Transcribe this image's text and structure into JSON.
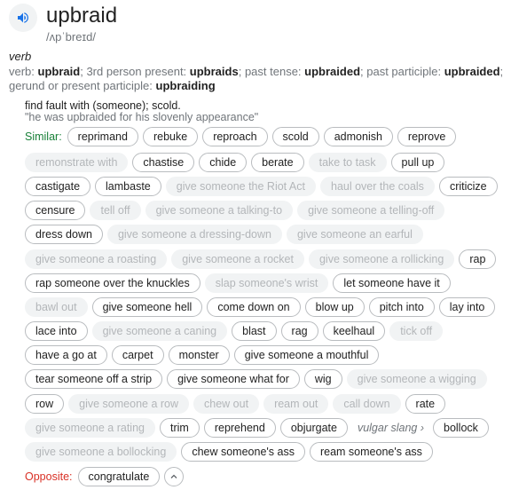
{
  "entry": {
    "word": "upbraid",
    "phonetic": "/ʌpˈbreɪd/",
    "part_of_speech": "verb"
  },
  "forms": {
    "verb_label": "verb:",
    "verb": "upbraid",
    "p3_label": "3rd person present:",
    "p3": "upbraids",
    "past_label": "past tense:",
    "past": "upbraided",
    "pp_label": "past participle:",
    "pp": "upbraided",
    "ger_label": "gerund or present participle:",
    "ger": "upbraiding"
  },
  "definition": "find fault with (someone); scold.",
  "example": "\"he was upbraided for his slovenly appearance\"",
  "similar_label": "Similar:",
  "opposite_label": "Opposite:",
  "vulgar_slang_label": "vulgar slang",
  "rows": [
    [
      [
        "reprimand",
        true
      ],
      [
        "rebuke",
        true
      ],
      [
        "reproach",
        true
      ],
      [
        "scold",
        true
      ],
      [
        "admonish",
        true
      ],
      [
        "reprove",
        true
      ]
    ],
    [
      [
        "remonstrate with",
        false
      ],
      [
        "chastise",
        true
      ],
      [
        "chide",
        true
      ],
      [
        "berate",
        true
      ],
      [
        "take to task",
        false
      ],
      [
        "pull up",
        true
      ]
    ],
    [
      [
        "castigate",
        true
      ],
      [
        "lambaste",
        true
      ],
      [
        "give someone the Riot Act",
        false
      ],
      [
        "haul over the coals",
        false
      ],
      [
        "criticize",
        true
      ]
    ],
    [
      [
        "censure",
        true
      ],
      [
        "tell off",
        false
      ],
      [
        "give someone a talking-to",
        false
      ],
      [
        "give someone a telling-off",
        false
      ]
    ],
    [
      [
        "dress down",
        true
      ],
      [
        "give someone a dressing-down",
        false
      ],
      [
        "give someone an earful",
        false
      ]
    ],
    [
      [
        "give someone a roasting",
        false
      ],
      [
        "give someone a rocket",
        false
      ],
      [
        "give someone a rollicking",
        false
      ],
      [
        "rap",
        true
      ]
    ],
    [
      [
        "rap someone over the knuckles",
        true
      ],
      [
        "slap someone's wrist",
        false
      ],
      [
        "let someone have it",
        true
      ]
    ],
    [
      [
        "bawl out",
        false
      ],
      [
        "give someone hell",
        true
      ],
      [
        "come down on",
        true
      ],
      [
        "blow up",
        true
      ],
      [
        "pitch into",
        true
      ],
      [
        "lay into",
        true
      ]
    ],
    [
      [
        "lace into",
        true
      ],
      [
        "give someone a caning",
        false
      ],
      [
        "blast",
        true
      ],
      [
        "rag",
        true
      ],
      [
        "keelhaul",
        true
      ],
      [
        "tick off",
        false
      ]
    ],
    [
      [
        "have a go at",
        true
      ],
      [
        "carpet",
        true
      ],
      [
        "monster",
        true
      ],
      [
        "give someone a mouthful",
        true
      ]
    ],
    [
      [
        "tear someone off a strip",
        true
      ],
      [
        "give someone what for",
        true
      ],
      [
        "wig",
        true
      ],
      [
        "give someone a wigging",
        false
      ]
    ],
    [
      [
        "row",
        true
      ],
      [
        "give someone a row",
        false
      ],
      [
        "chew out",
        false
      ],
      [
        "ream out",
        false
      ],
      [
        "call down",
        false
      ],
      [
        "rate",
        true
      ]
    ],
    [
      [
        "give someone a rating",
        false
      ],
      [
        "trim",
        true
      ],
      [
        "reprehend",
        true
      ],
      [
        "objurgate",
        true
      ]
    ],
    [
      [
        "give someone a bollocking",
        false
      ],
      [
        "chew someone's ass",
        true
      ],
      [
        "ream someone's ass",
        true
      ]
    ]
  ],
  "slang_chip": "bollock",
  "opposite": "congratulate",
  "colors": {
    "similar": "#188038",
    "opposite": "#d93025",
    "speaker": "#1a73e8",
    "chip_border": "#b9bcbf",
    "chip_disabled_bg": "#f1f3f4",
    "chip_disabled_text": "#b3b6b9"
  },
  "icons": {
    "speaker": "speaker-icon",
    "slang_arrow": "chevron-right-icon",
    "collapse": "chevron-up-icon"
  }
}
